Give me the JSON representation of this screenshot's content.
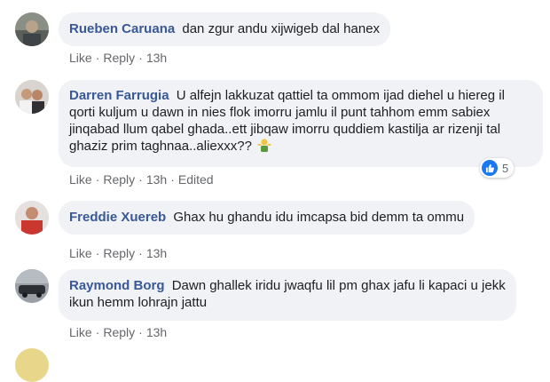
{
  "comments": [
    {
      "author": "Rueben Caruana",
      "text": "dan zgur andu xijwigeb dal hanex",
      "like": "Like",
      "reply": "Reply",
      "time": "13h"
    },
    {
      "author": "Darren Farrugia",
      "text": "U alfejn lakkuzat qattiel ta ommom ijad diehel u hiereg il qorti kuljum u dawn in nies flok imorru jamlu il punt tahhom emm sabiex jinqabad llum qabel ghada..ett jibqaw imorru quddiem kastilja ar rizenji tal ghaziz prim taghnaa..aliexxx??",
      "emoji": "man-shrugging",
      "like": "Like",
      "reply": "Reply",
      "time": "13h",
      "edited": "Edited",
      "reaction_count": "5",
      "reaction_icon": "like-icon"
    },
    {
      "author": "Freddie Xuereb",
      "text": "Ghax hu ghandu idu imcapsa bid demm ta ommu",
      "like": "Like",
      "reply": "Reply",
      "time": "13h"
    },
    {
      "author": "Raymond Borg",
      "text": "Dawn ghallek iridu jwaqfu lil pm ghax jafu li kapaci u jekk ikun hemm lohrajn jattu",
      "like": "Like",
      "reply": "Reply",
      "time": "13h"
    }
  ],
  "colors": {
    "author": "#385898",
    "bubble": "#f0f2f5",
    "meta": "#65676b",
    "like_blue": "#1877f2"
  }
}
